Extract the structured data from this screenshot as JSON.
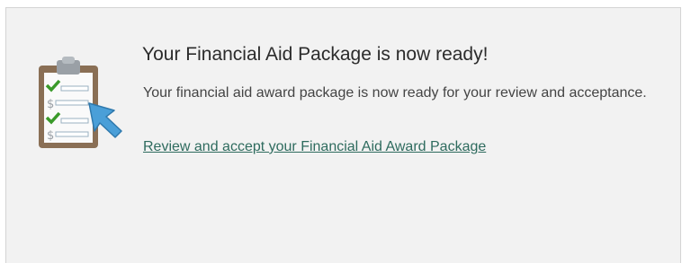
{
  "notice": {
    "title": "Your Financial Aid Package is now ready!",
    "message": "Your financial aid award package is now ready for your review and acceptance.",
    "link_text": "Review and accept your Financial Aid Award Package",
    "icon": "clipboard-checklist-icon"
  },
  "colors": {
    "panel_background": "#f2f2f2",
    "link": "#2e6b5e",
    "clipboard_frame": "#8a6f55",
    "checkmark": "#3a9a2a",
    "cursor_arrow": "#4a9fd8"
  }
}
